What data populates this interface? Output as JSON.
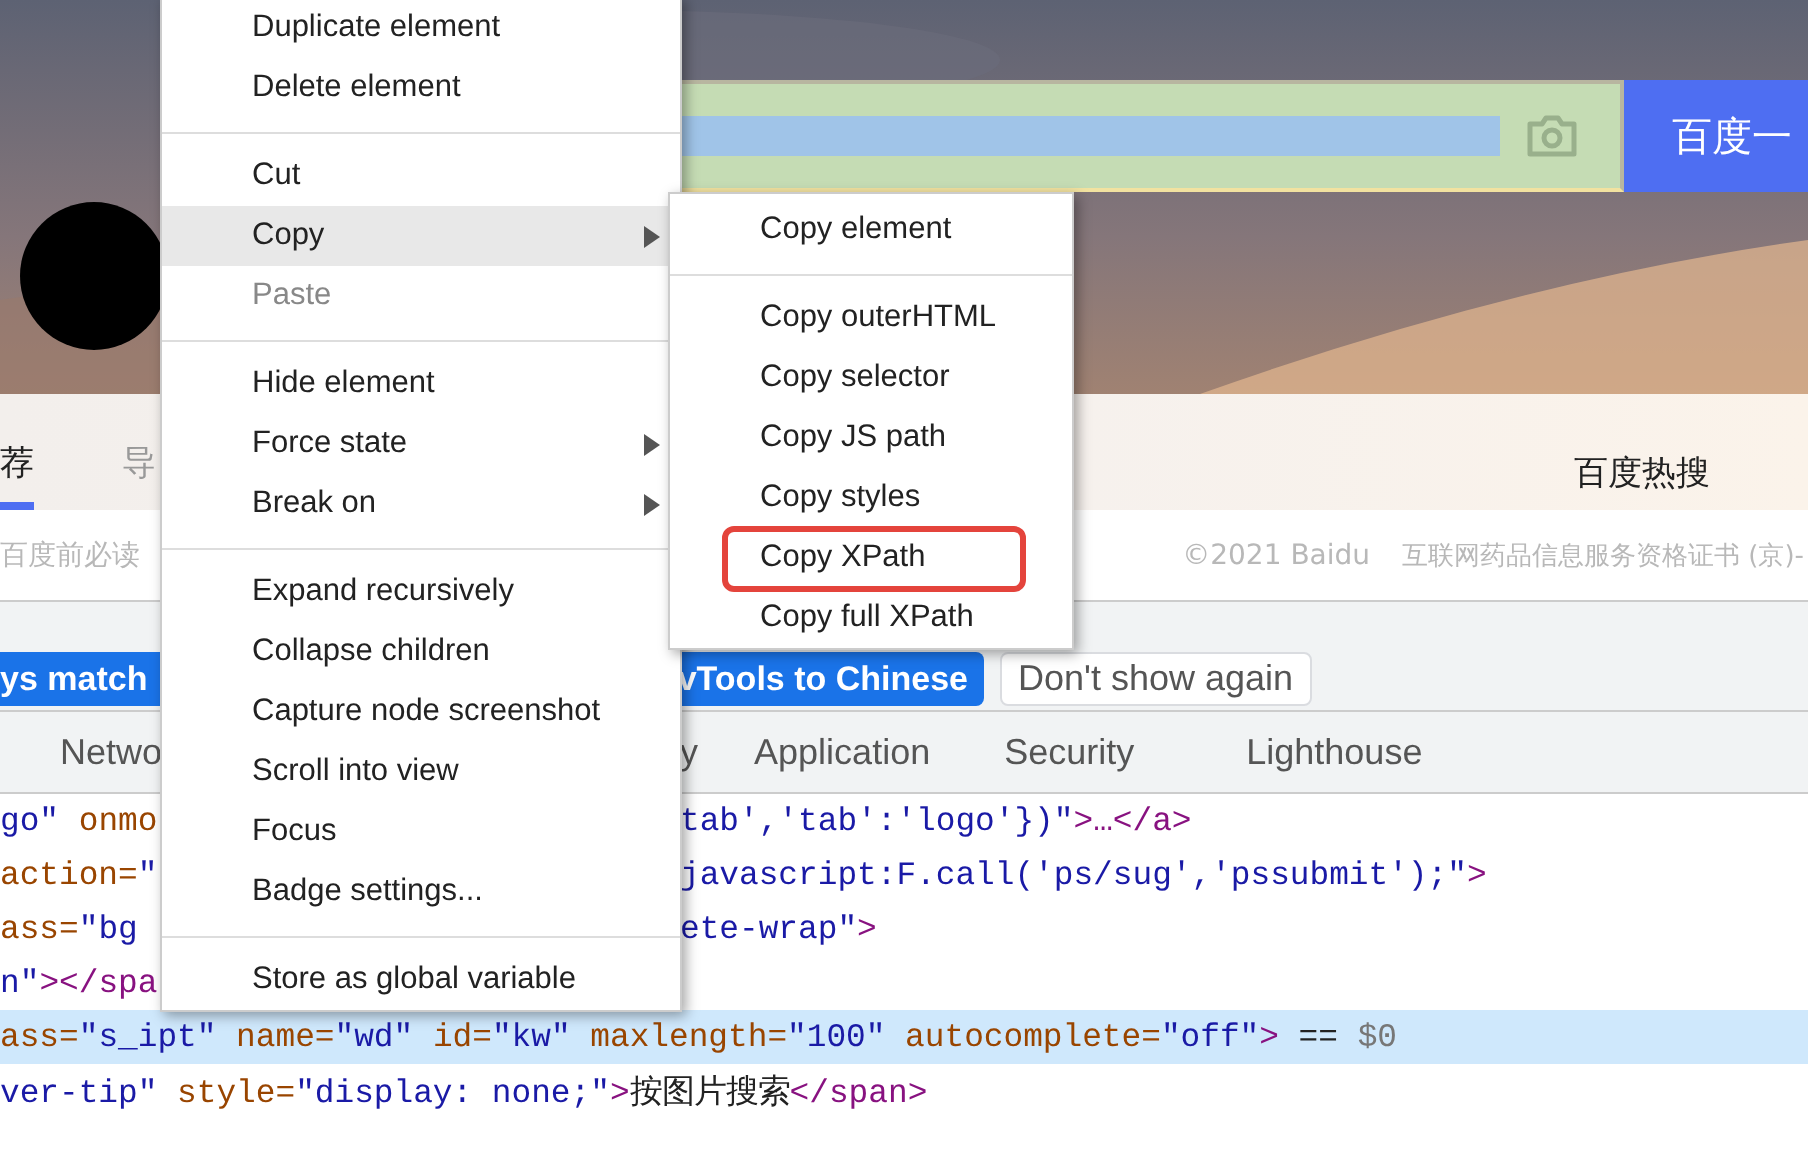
{
  "page": {
    "search": {
      "button": "百度一"
    },
    "tabs": [
      {
        "label": "荐",
        "selected": true
      },
      {
        "label": "导",
        "selected": false
      }
    ],
    "hot_search": "百度热搜",
    "footer": [
      "百度前必读",
      "©2021 Baidu",
      "互联网药品信息服务资格证书 (京)-"
    ],
    "banner": {
      "buttons": [
        {
          "label": "ys match",
          "kind": "primary"
        },
        {
          "label": "vTools to Chinese",
          "kind": "primary"
        },
        {
          "label": "Don't show again",
          "kind": "secondary"
        }
      ]
    },
    "devtools_tabs": [
      "Netwo",
      "y",
      "Application",
      "Security",
      "Lighthouse"
    ],
    "code_lines": [
      {
        "kind": "split",
        "selected": false,
        "left": [
          {
            "t": "go\"",
            "kind": "val"
          },
          {
            "t": " onmo",
            "kind": "attr"
          }
        ],
        "right": [
          {
            "t": "tab','tab':'logo'})\"",
            "kind": "val"
          },
          {
            "t": ">…</a>",
            "kind": "tag"
          }
        ]
      },
      {
        "kind": "split",
        "selected": false,
        "left": [
          {
            "t": "action=",
            "kind": "attr"
          },
          {
            "t": "\"",
            "kind": "val"
          }
        ],
        "right": [
          {
            "t": "javascript:F.call('ps/sug','pssubmit');\"",
            "kind": "val"
          },
          {
            "t": ">",
            "kind": "tag"
          }
        ]
      },
      {
        "kind": "split",
        "selected": false,
        "left": [
          {
            "t": "ass=",
            "kind": "attr"
          },
          {
            "t": "\"bg",
            "kind": "val"
          }
        ],
        "right": [
          {
            "t": "ete-wrap\"",
            "kind": "val"
          },
          {
            "t": ">",
            "kind": "tag"
          }
        ]
      },
      {
        "kind": "split",
        "selected": false,
        "left": [
          {
            "t": "n\"",
            "kind": "val"
          },
          {
            "t": "></spa",
            "kind": "tag"
          }
        ]
      },
      {
        "kind": "full",
        "selected": true,
        "left": [
          {
            "t": "ass=",
            "kind": "attr"
          },
          {
            "t": "\"s_ipt\"",
            "kind": "val"
          },
          {
            "t": " name=",
            "kind": "attr"
          },
          {
            "t": "\"wd\"",
            "kind": "val"
          },
          {
            "t": " id=",
            "kind": "attr"
          },
          {
            "t": "\"kw\"",
            "kind": "val"
          },
          {
            "t": " maxlength=",
            "kind": "attr"
          },
          {
            "t": "\"100\"",
            "kind": "val"
          },
          {
            "t": " autocomplete=",
            "kind": "attr"
          },
          {
            "t": "\"off\"",
            "kind": "val"
          },
          {
            "t": ">",
            "kind": "tag"
          },
          {
            "t": " == ",
            "kind": "plain"
          },
          {
            "t": "$0",
            "kind": "ref"
          }
        ]
      },
      {
        "kind": "full",
        "selected": false,
        "left": [
          {
            "t": "ver-tip\"",
            "kind": "val"
          },
          {
            "t": " style=",
            "kind": "attr"
          },
          {
            "t": "\"display: none;\"",
            "kind": "val"
          },
          {
            "t": ">",
            "kind": "tag"
          },
          {
            "t": "按图片搜索",
            "kind": "plain"
          },
          {
            "t": "</span>",
            "kind": "tag"
          }
        ]
      }
    ]
  },
  "context_menu": {
    "items": [
      {
        "kind": "item",
        "label": "Duplicate element",
        "hovered": false,
        "disabled": false,
        "submenu": false
      },
      {
        "kind": "item",
        "label": "Delete element",
        "hovered": false,
        "disabled": false,
        "submenu": false
      },
      {
        "kind": "separator"
      },
      {
        "kind": "item",
        "label": "Cut",
        "hovered": false,
        "disabled": false,
        "submenu": false
      },
      {
        "kind": "item",
        "label": "Copy",
        "hovered": true,
        "disabled": false,
        "submenu": true
      },
      {
        "kind": "item",
        "label": "Paste",
        "hovered": false,
        "disabled": true,
        "submenu": false
      },
      {
        "kind": "separator"
      },
      {
        "kind": "item",
        "label": "Hide element",
        "hovered": false,
        "disabled": false,
        "submenu": false
      },
      {
        "kind": "item",
        "label": "Force state",
        "hovered": false,
        "disabled": false,
        "submenu": true
      },
      {
        "kind": "item",
        "label": "Break on",
        "hovered": false,
        "disabled": false,
        "submenu": true
      },
      {
        "kind": "separator"
      },
      {
        "kind": "item",
        "label": "Expand recursively",
        "hovered": false,
        "disabled": false,
        "submenu": false
      },
      {
        "kind": "item",
        "label": "Collapse children",
        "hovered": false,
        "disabled": false,
        "submenu": false
      },
      {
        "kind": "item",
        "label": "Capture node screenshot",
        "hovered": false,
        "disabled": false,
        "submenu": false
      },
      {
        "kind": "item",
        "label": "Scroll into view",
        "hovered": false,
        "disabled": false,
        "submenu": false
      },
      {
        "kind": "item",
        "label": "Focus",
        "hovered": false,
        "disabled": false,
        "submenu": false
      },
      {
        "kind": "item",
        "label": "Badge settings...",
        "hovered": false,
        "disabled": false,
        "submenu": false
      },
      {
        "kind": "separator"
      },
      {
        "kind": "item",
        "label": "Store as global variable",
        "hovered": false,
        "disabled": false,
        "submenu": false
      }
    ]
  },
  "copy_submenu": {
    "items": [
      {
        "kind": "item",
        "label": "Copy element",
        "annotated": false
      },
      {
        "kind": "separator"
      },
      {
        "kind": "item",
        "label": "Copy outerHTML",
        "annotated": false
      },
      {
        "kind": "item",
        "label": "Copy selector",
        "annotated": false
      },
      {
        "kind": "item",
        "label": "Copy JS path",
        "annotated": false
      },
      {
        "kind": "item",
        "label": "Copy styles",
        "annotated": false
      },
      {
        "kind": "item",
        "label": "Copy XPath",
        "annotated": true
      },
      {
        "kind": "item",
        "label": "Copy full XPath",
        "annotated": false
      }
    ]
  }
}
